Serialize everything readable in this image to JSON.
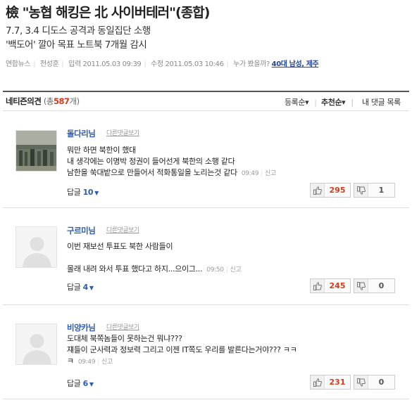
{
  "article": {
    "headline": "檢 \"농협 해킹은 北 사이버테러\"(종합)",
    "sub1": "7.7, 3.4 디도스 공격과 동일집단 소행",
    "sub2": "'백도어' 깔아 목표 노트북 7개월 감시",
    "source": "연합뉴스",
    "reporter": "전성훈",
    "input_label": "입력",
    "input_time": "2011.05.03 09:39",
    "edit_label": "수정",
    "edit_time": "2011.05.03 10:46",
    "who_saw": "누가 봤을까?",
    "who_saw_value": "40대 남성, 제주"
  },
  "comments_header": {
    "title": "네티즌의견",
    "total_prefix": "(총",
    "total": "587",
    "total_suffix": "개)",
    "sort_options": [
      "등록순",
      "추천순",
      "내 댓글 목록"
    ]
  },
  "comments": [
    {
      "nickname": "돌다리님",
      "other_replies": "다른댓글보기",
      "lines": [
        "뭐만 하면 북한이 했대",
        "내 생각에는 이명박 정권이 들어선게 북한의 소행 같다",
        "남한을 쑥대밭으로 만들어서 적화통일을 노리는것 같다"
      ],
      "time": "09:49",
      "report": "신고",
      "reply_label": "답글",
      "reply_count": "10",
      "up": "295",
      "down": "1"
    },
    {
      "nickname": "구르미님",
      "other_replies": "다른댓글보기",
      "lines": [
        "이번 재보선 투표도 북한 사람들이",
        "몰래 내려 와서 투표 했다고 하지...으이그..."
      ],
      "time": "09:50",
      "report": "신고",
      "reply_label": "답글",
      "reply_count": "4",
      "up": "245",
      "down": "0"
    },
    {
      "nickname": "비양카님",
      "other_replies": "다른댓글보기",
      "lines": [
        "도대체 북쪽놈들이 못하는건 뭐냐???",
        "쟤들이 군사력과 정보력 그리고 이젠 IT쪽도 우리를 발른다는거야??? ㅋㅋ",
        "ㅋ"
      ],
      "time": "09:49",
      "report": "신고",
      "reply_label": "답글",
      "reply_count": "6",
      "up": "231",
      "down": "0"
    }
  ],
  "colors": {
    "accent_red": "#d63b1b",
    "link_blue": "#2c5bb0"
  }
}
